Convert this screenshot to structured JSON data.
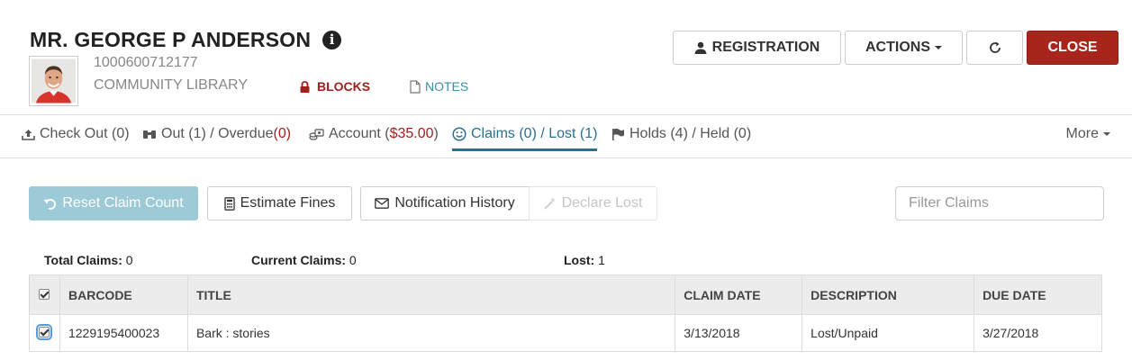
{
  "patron": {
    "name": "MR. GEORGE P ANDERSON",
    "barcode": "1000600712177",
    "library": "COMMUNITY LIBRARY",
    "blocks_label": "BLOCKS",
    "notes_label": "NOTES"
  },
  "header_buttons": {
    "registration": "REGISTRATION",
    "actions": "ACTIONS",
    "close": "CLOSE"
  },
  "tabs": [
    {
      "pre": "Check Out (0)",
      "red": "",
      "post": "",
      "icon": "upload-icon"
    },
    {
      "pre": "Out (1) / Overdue ",
      "red": "(0)",
      "post": "",
      "icon": "binoculars-icon"
    },
    {
      "pre": "Account (",
      "red": "$35.00",
      "post": ")",
      "icon": "money-icon"
    },
    {
      "pre": "Claims (0) / Lost (1)",
      "red": "",
      "post": "",
      "icon": "smile-icon",
      "active": true
    },
    {
      "pre": "Holds (4) / Held (0)",
      "red": "",
      "post": "",
      "icon": "flag-icon"
    }
  ],
  "more_label": "More",
  "actions": {
    "reset": "Reset Claim Count",
    "estimate": "Estimate Fines",
    "notification": "Notification History",
    "declare": "Declare Lost",
    "filter_placeholder": "Filter Claims"
  },
  "stats": {
    "total_label": "Total Claims:",
    "total_value": " 0",
    "current_label": "Current Claims:",
    "current_value": " 0",
    "lost_label": "Lost:",
    "lost_value": " 1"
  },
  "table": {
    "columns": [
      "BARCODE",
      "TITLE",
      "CLAIM DATE",
      "DESCRIPTION",
      "DUE DATE"
    ],
    "rows": [
      {
        "barcode": "1229195400023",
        "title": "Bark : stories",
        "claim_date": "3/13/2018",
        "description": "Lost/Unpaid",
        "due_date": "3/27/2018",
        "checked": true
      }
    ]
  },
  "colors": {
    "accent": "#2a6f8f",
    "danger": "#a8251b",
    "reset_button": "#9ccad6"
  }
}
